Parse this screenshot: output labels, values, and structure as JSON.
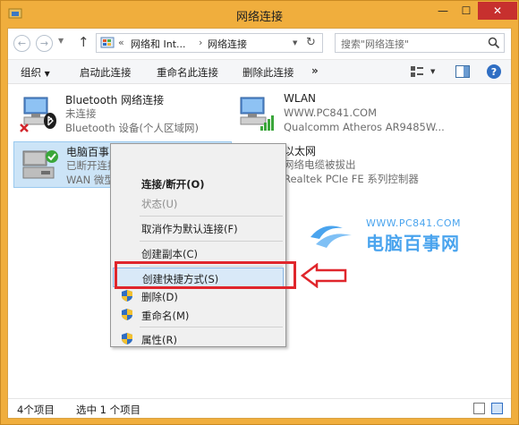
{
  "window": {
    "title": "网络连接"
  },
  "nav": {
    "breadcrumb_prefix": "«",
    "crumbs": [
      "网络和 Int...",
      "网络连接"
    ],
    "crumb_sep": "›",
    "search_placeholder": "搜索\"网络连接\""
  },
  "toolbar": {
    "organize": "组织",
    "start_connection": "启动此连接",
    "rename_connection": "重命名此连接",
    "delete_connection": "删除此连接",
    "more": "»"
  },
  "connections": [
    {
      "name": "Bluetooth 网络连接",
      "status": "未连接",
      "device": "Bluetooth 设备(个人区域网)"
    },
    {
      "name": "WLAN",
      "status": "WWW.PC841.COM",
      "device": "Qualcomm Atheros AR9485W..."
    },
    {
      "name": "电脑百事网网络连接",
      "status": "已断开连接",
      "device": "WAN 微型"
    },
    {
      "name": "以太网",
      "status": "网络电缆被拔出",
      "device": "Realtek PCIe FE 系列控制器"
    }
  ],
  "context_menu": {
    "items": [
      {
        "label": "连接/断开(O)"
      },
      {
        "label": "状态(U)"
      },
      {
        "label": "取消作为默认连接(F)"
      },
      {
        "label": "创建副本(C)"
      },
      {
        "label": "创建快捷方式(S)"
      },
      {
        "label": "删除(D)"
      },
      {
        "label": "重命名(M)"
      },
      {
        "label": "属性(R)"
      }
    ]
  },
  "watermark": {
    "url": "WWW.PC841.COM",
    "brand": "电脑百事网"
  },
  "statusbar": {
    "item_count": "4个项目",
    "selected": "选中 1 个项目"
  },
  "colors": {
    "title_bar": "#f0ae3d",
    "close_button": "#c7302e",
    "selection": "#cce4f7",
    "highlight_box": "#e0262c",
    "watermark": "#4aa4ee"
  }
}
